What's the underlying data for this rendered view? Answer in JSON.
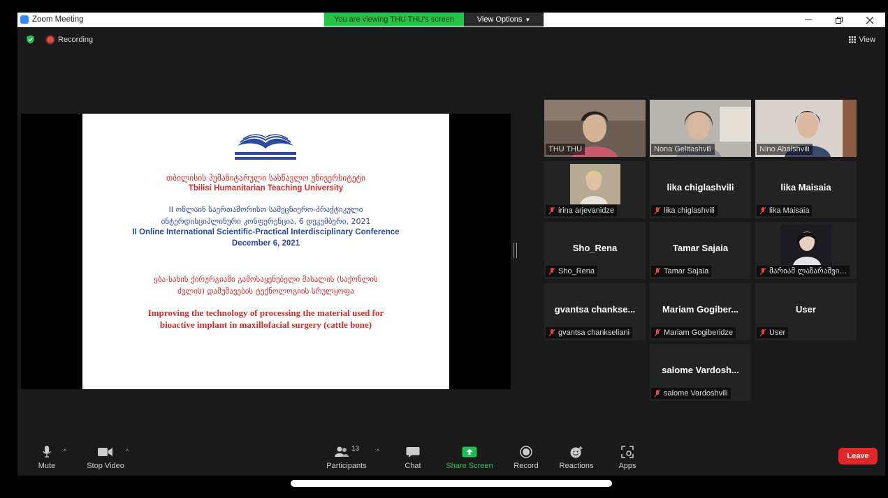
{
  "window": {
    "title": "Zoom Meeting",
    "viewing_banner": "You are viewing THU THU's screen",
    "view_options_label": "View Options"
  },
  "status": {
    "recording_label": "Recording",
    "view_label": "View"
  },
  "slide": {
    "university_ka": "თბილისის ჰუმანიტარული სასწავლო უნივერსიტეტი",
    "university_en": "Tbilisi Humanitarian Teaching University",
    "conf_ka_1": "II ონლაინ საერთაშორისო სამეცნიერო-პრაქტიკული",
    "conf_ka_2": "ინტერდისციპლინური კონფერენცია, 6 დეკემბერი, 2021",
    "conf_en_1": "II Online International Scientific-Practical Interdisciplinary Conference",
    "conf_en_2": "December 6, 2021",
    "topic_ka_1": "ყბა-სახის ქირურგიაში გამოსაყენებელი მასალის (საქონლის",
    "topic_ka_2": "ძვლის)  დამუშავების ტექნოლოგიის სრულყოფა",
    "topic_en_1": "Improving the technology of processing the material used for",
    "topic_en_2": "bioactive implant in maxillofacial surgery (cattle bone)"
  },
  "participants": [
    {
      "label": "THU THU",
      "center": "",
      "muted": false
    },
    {
      "label": "Nona Gelitashvili",
      "center": "",
      "muted": false
    },
    {
      "label": "Nino Abaishvili",
      "center": "",
      "muted": false
    },
    {
      "label": "irina arjevanidze",
      "center": "",
      "muted": true
    },
    {
      "label": "lika chiglashvili",
      "center": "lika chiglashvili",
      "muted": true
    },
    {
      "label": "lika Maisaia",
      "center": "lika Maisaia",
      "muted": true
    },
    {
      "label": "Sho_Rena",
      "center": "Sho_Rena",
      "muted": true
    },
    {
      "label": "Tamar Sajaia",
      "center": "Tamar Sajaia",
      "muted": true
    },
    {
      "label": "მარიამ ლაზარაშვი...",
      "center": "",
      "muted": true
    },
    {
      "label": "gvantsa chankseliani",
      "center": "gvantsa chankse...",
      "muted": true
    },
    {
      "label": "Mariam Gogiberidze",
      "center": "Mariam  Gogiber...",
      "muted": true
    },
    {
      "label": "User",
      "center": "User",
      "muted": true
    },
    {
      "label": "salome Vardoshvili",
      "center": "salome  Vardosh...",
      "muted": true
    }
  ],
  "toolbar": {
    "mute": "Mute",
    "stop_video": "Stop Video",
    "participants": "Participants",
    "participants_count": "13",
    "chat": "Chat",
    "share_screen": "Share Screen",
    "record": "Record",
    "reactions": "Reactions",
    "apps": "Apps",
    "leave": "Leave"
  },
  "colors": {
    "banner_green": "#27c24c",
    "slide_red": "#d42a2a",
    "slide_blue": "#2a4aa0",
    "active_speaker": "#c9e84a",
    "leave_red": "#e02828",
    "share_green": "#1fbf57"
  }
}
